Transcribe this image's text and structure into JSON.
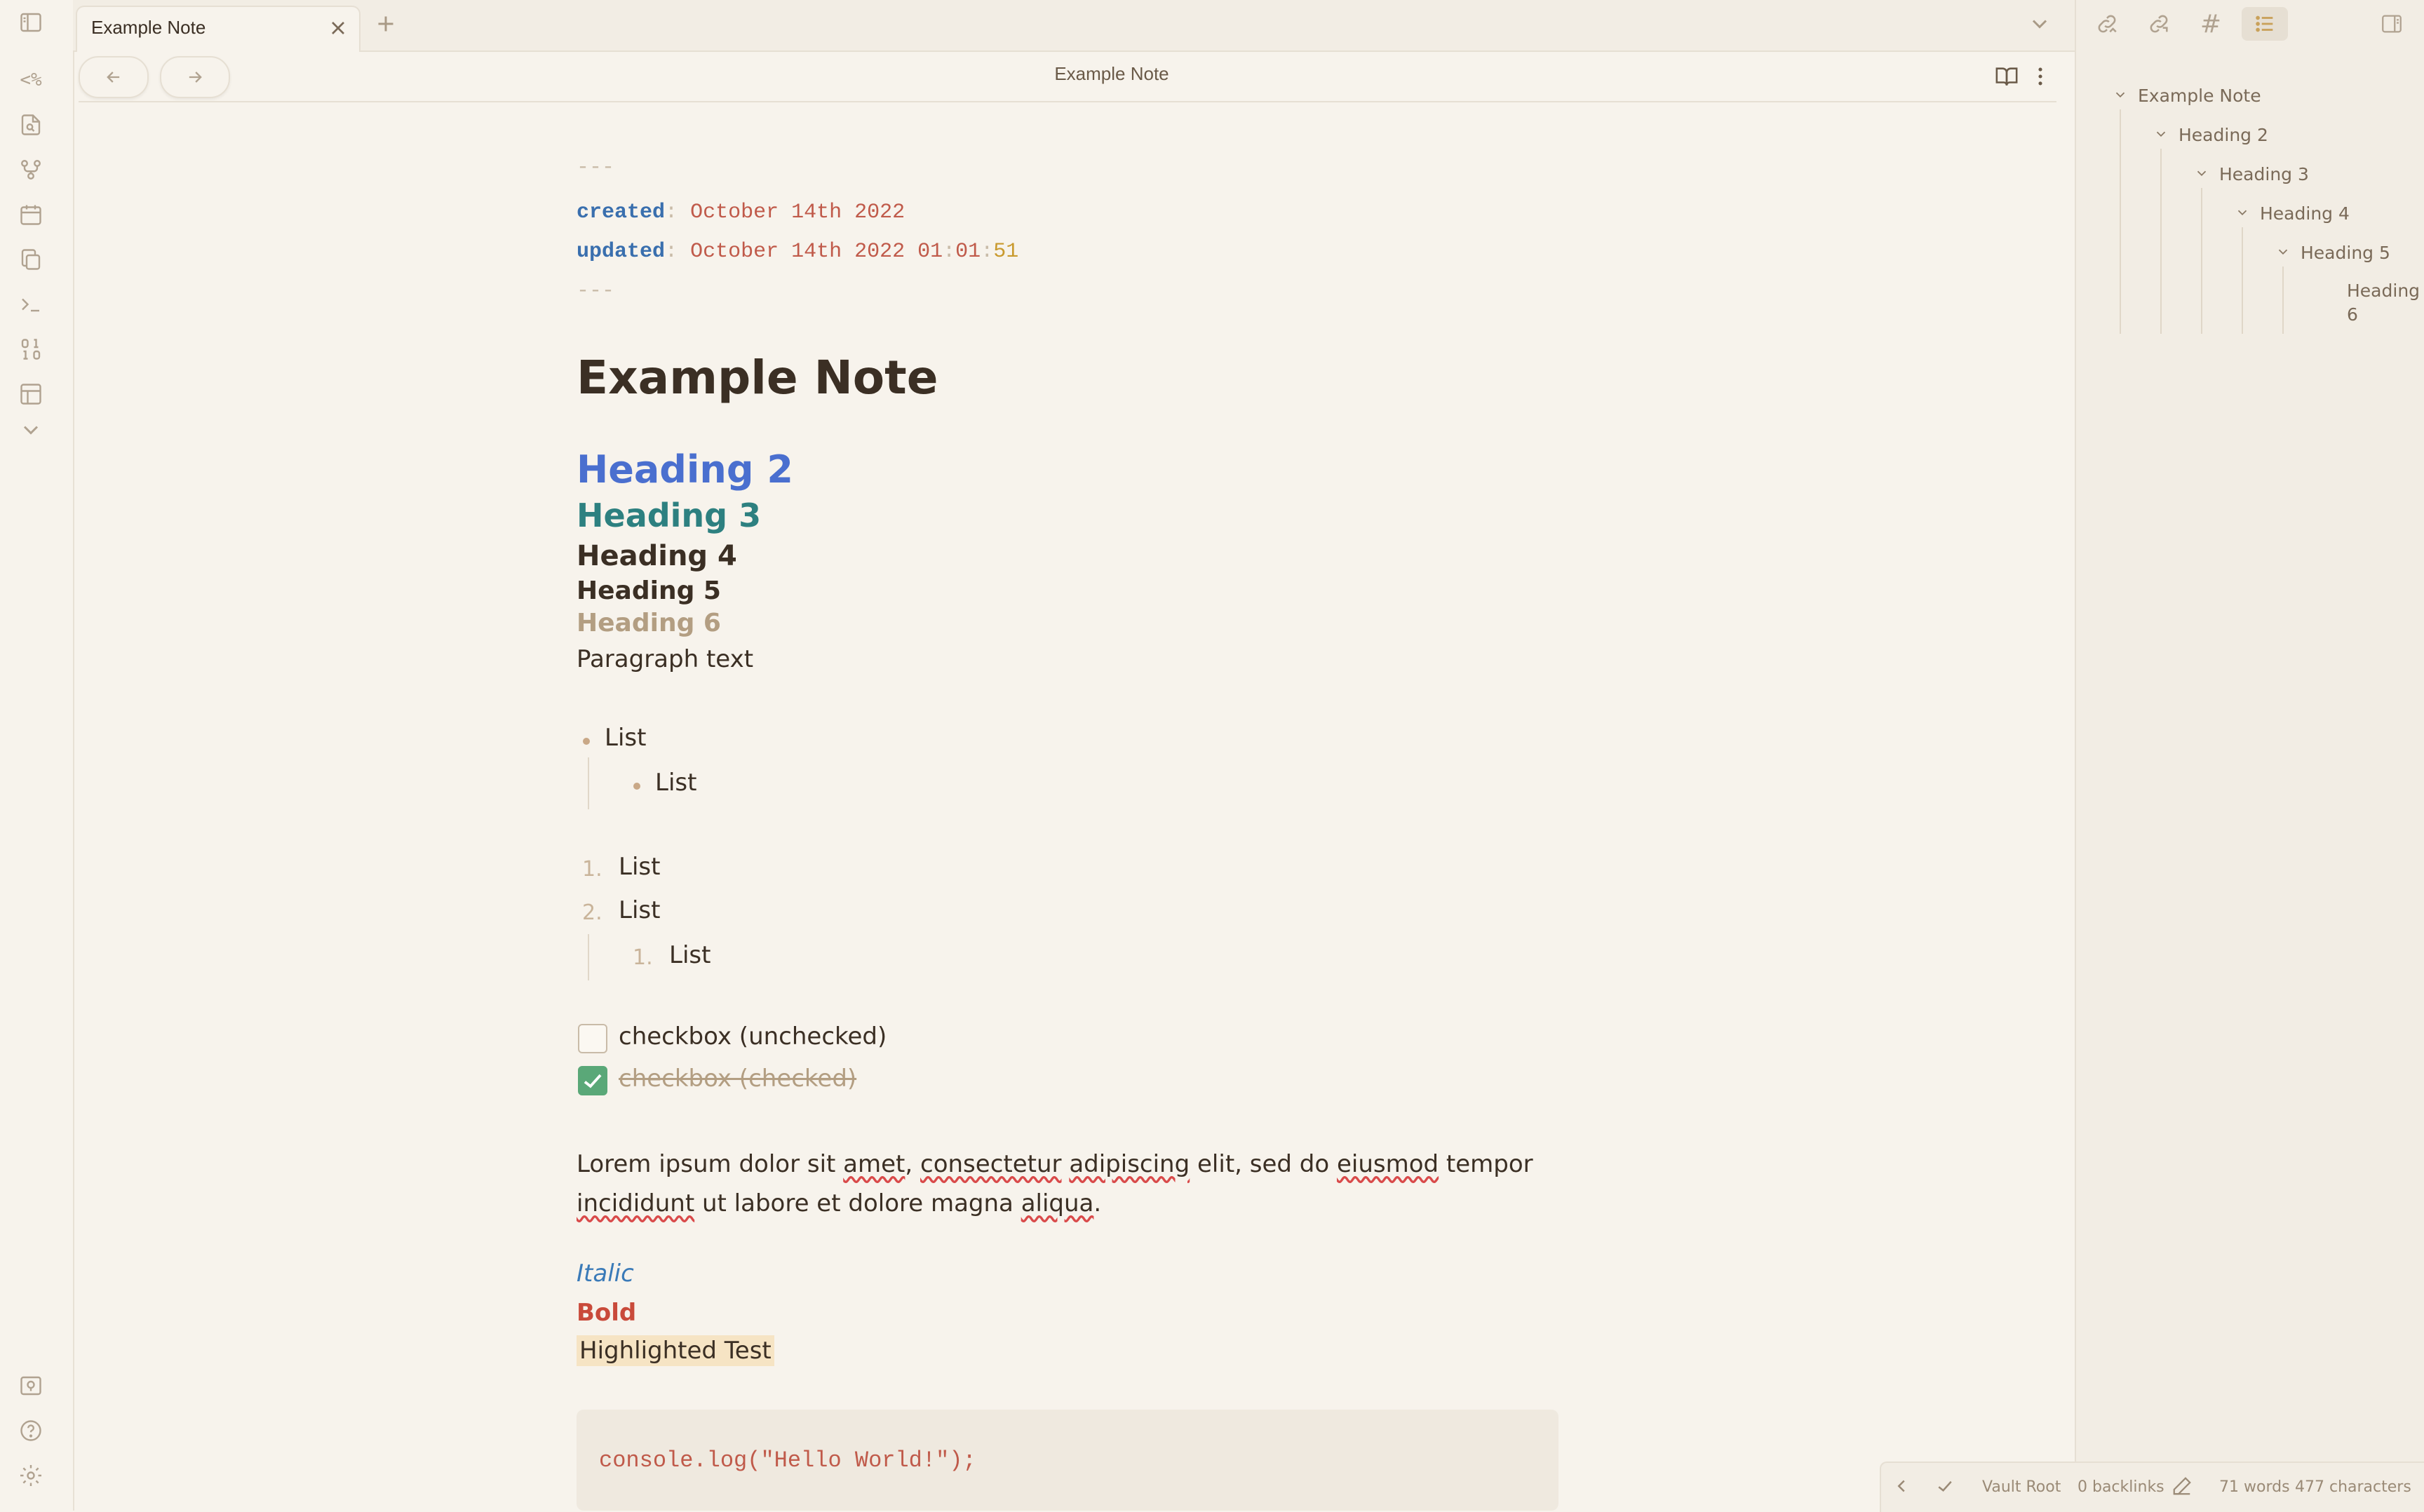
{
  "tab": {
    "title": "Example Note",
    "close_icon": "close-icon",
    "new_tab_icon": "plus-icon",
    "dropdown_icon": "chevron-down-icon"
  },
  "ribbon": {
    "icons": [
      "templater-icon",
      "file-search-icon",
      "graph-icon",
      "calendar-icon",
      "copy-icon",
      "terminal-icon",
      "binary-icon",
      "layout-icon",
      "chevron-down-icon"
    ],
    "templater_glyph": "<%",
    "bottom_icons": [
      "vault-icon",
      "help-icon",
      "settings-icon"
    ]
  },
  "header": {
    "title": "Example Note",
    "back_icon": "arrow-left-icon",
    "forward_icon": "arrow-right-icon",
    "reading_icon": "book-open-icon",
    "more_icon": "more-vertical-icon"
  },
  "frontmatter": {
    "dashes": "---",
    "created_key": "created",
    "created_value": "October 14th 2022",
    "updated_key": "updated",
    "updated_date": "October 14th 2022",
    "updated_hh": "01",
    "updated_mm": "01",
    "updated_ss": "51",
    "colon": ":"
  },
  "content": {
    "h1": "Example Note",
    "h2": "Heading 2",
    "h3": "Heading 3",
    "h4": "Heading 4",
    "h5": "Heading 5",
    "h6": "Heading 6",
    "paragraph": "Paragraph text",
    "bullet_list": [
      "List",
      "List"
    ],
    "ordered_list": [
      {
        "num": "1.",
        "text": "List"
      },
      {
        "num": "2.",
        "text": "List"
      },
      {
        "num": "1.",
        "text": "List"
      }
    ],
    "checkbox_unchecked": "checkbox (unchecked)",
    "checkbox_checked": "checkbox (checked)",
    "lorem_words": [
      "Lorem ipsum dolor sit ",
      "amet",
      ", ",
      "consectetur",
      " ",
      "adipiscing",
      " elit, sed do ",
      "eiusmod",
      " tempor"
    ],
    "lorem_line2": [
      "incididunt",
      " ut labore et dolore magna ",
      "aliqua",
      "."
    ],
    "italic": "Italic",
    "bold": "Bold",
    "highlight": "Highlighted Test",
    "code": "console.log(\"Hello World!\");"
  },
  "right_toolbar": {
    "icons": [
      "backlinks-icon",
      "outgoing-links-icon",
      "tags-icon",
      "outline-icon"
    ],
    "tags_glyph": "#",
    "toggle_icon": "sidebar-right-icon"
  },
  "outline": {
    "items": [
      "Example Note",
      "Heading 2",
      "Heading 3",
      "Heading 4",
      "Heading 5",
      "Heading",
      "6"
    ]
  },
  "statusbar": {
    "vault": "Vault Root",
    "backlinks": "0 backlinks",
    "words": "71 words",
    "characters": "477 characters"
  },
  "colors": {
    "background": "#f7f3ec",
    "panel": "#f2ede4",
    "h2": "#4a6fcf",
    "h3": "#2d8080",
    "h6": "#b39e82",
    "bold": "#c94a3a",
    "italic": "#3a7ab8",
    "highlight": "#f6e4c4",
    "checkbox_checked": "#5aa878"
  }
}
